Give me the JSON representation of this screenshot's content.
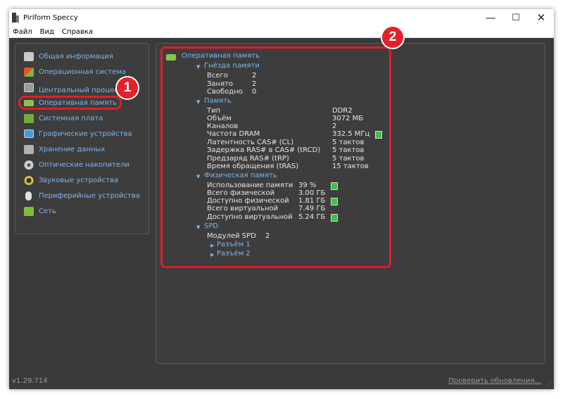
{
  "window": {
    "title": "Piriform Speccy",
    "controls": {
      "minimize": "—",
      "maximize": "☐",
      "close": "✕"
    }
  },
  "menu": [
    "Файл",
    "Вид",
    "Справка"
  ],
  "sidebar": {
    "items": [
      {
        "label": "Общая информация",
        "icon": "summary-icon",
        "color": "#c9c9c9"
      },
      {
        "label": "Операционная система",
        "icon": "windows-logo-icon",
        "color": "#e8892b"
      },
      {
        "label": "Центральный процессор",
        "icon": "cpu-icon",
        "color": "#9a9a9a"
      },
      {
        "label": "Оперативная память",
        "icon": "ram-icon",
        "color": "#8bc34a"
      },
      {
        "label": "Системная плата",
        "icon": "motherboard-icon",
        "color": "#6fae3c"
      },
      {
        "label": "Графические устройства",
        "icon": "monitor-icon",
        "color": "#4a9bd9"
      },
      {
        "label": "Хранение данных",
        "icon": "hdd-icon",
        "color": "#b0b0b0"
      },
      {
        "label": "Оптические накопители",
        "icon": "optical-disc-icon",
        "color": "#d0d0d0"
      },
      {
        "label": "Звуковые устройства",
        "icon": "speaker-icon",
        "color": "#d8c23a"
      },
      {
        "label": "Периферийные устройства",
        "icon": "mouse-icon",
        "color": "#e0e0e0"
      },
      {
        "label": "Сеть",
        "icon": "network-icon",
        "color": "#7cbf3e"
      }
    ]
  },
  "content": {
    "title": "Оперативная память",
    "slots": {
      "header": "Гнёзда памяти",
      "rows": [
        {
          "label": "Всего",
          "value": "2"
        },
        {
          "label": "Занято",
          "value": "2"
        },
        {
          "label": "Свободно",
          "value": "0"
        }
      ]
    },
    "memory": {
      "header": "Память",
      "rows": [
        {
          "label": "Тип",
          "value": "DDR2"
        },
        {
          "label": "Объём",
          "value": "3072 МБ"
        },
        {
          "label": "Каналов",
          "value": "2"
        },
        {
          "label": "Частота DRAM",
          "value": "332.5 МГц",
          "bar": true
        },
        {
          "label": "Латентность CAS# (CL)",
          "value": "5 тактов"
        },
        {
          "label": "Задержка RAS# в CAS# (tRCD)",
          "value": "5 тактов"
        },
        {
          "label": "Предзаряд RAS# (tRP)",
          "value": "5 тактов"
        },
        {
          "label": "Время обращения (tRAS)",
          "value": "15 тактов"
        }
      ]
    },
    "physical": {
      "header": "Физическая память",
      "rows": [
        {
          "label": "Использование памяти",
          "value": "39 %",
          "bar": true
        },
        {
          "label": "Всего физической",
          "value": "3.00 ГБ"
        },
        {
          "label": "Доступно физической",
          "value": "1.81 ГБ",
          "bar": true
        },
        {
          "label": "Всего виртуальной",
          "value": "7.49 ГБ"
        },
        {
          "label": "Доступно виртуальной",
          "value": "5.24 ГБ",
          "bar": true
        }
      ]
    },
    "spd": {
      "header": "SPD",
      "modules_label": "Модулей SPD",
      "modules_value": "2",
      "slots": [
        "Разъём 1",
        "Разъём 2"
      ]
    }
  },
  "status": {
    "version": "v1.29.714",
    "update_link": "Проверить обновления..."
  },
  "annotations": {
    "badge1": "1",
    "badge2": "2"
  },
  "colors": {
    "accent_link": "#7fb6ea",
    "highlight": "#e31c2a",
    "bar_green": "#3fc146"
  }
}
